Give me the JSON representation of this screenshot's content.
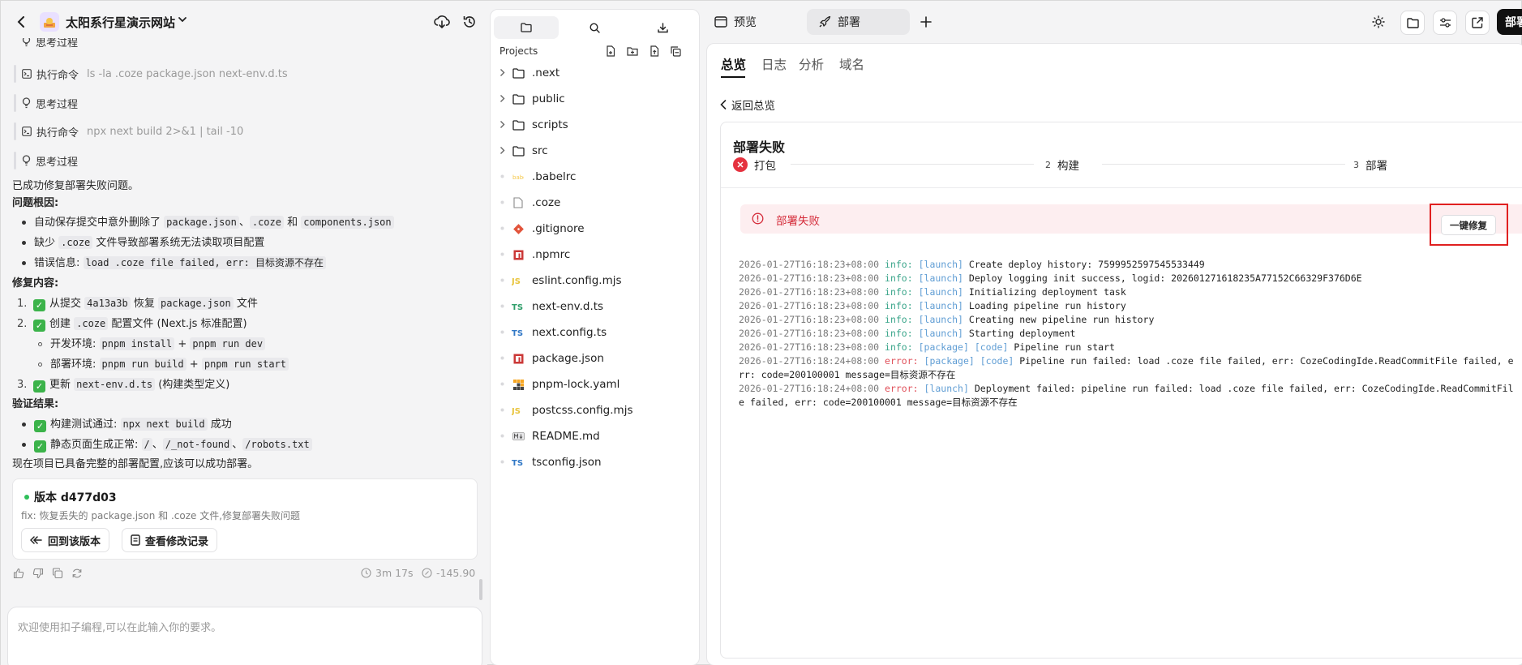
{
  "chat": {
    "project_title": "太阳系行星演示网站",
    "steps": [
      {
        "label": "思考过程",
        "cmd": ""
      },
      {
        "label": "执行命令",
        "cmd": "ls -la .coze package.json next-env.d.ts"
      },
      {
        "label": "思考过程",
        "cmd": ""
      },
      {
        "label": "执行命令",
        "cmd": "npx next build 2>&1 | tail -10"
      },
      {
        "label": "思考过程",
        "cmd": ""
      }
    ],
    "summary": "已成功修复部署失败问题。",
    "root_cause_heading": "问题根因:",
    "root_causes": {
      "c1_pre": "自动保存提交中意外删除了 ",
      "c1_code1": "package.json",
      "c1_sep": "、",
      "c1_code2": ".coze",
      "c1_and": " 和 ",
      "c1_code3": "components.json",
      "c2_pre": "缺少 ",
      "c2_code": ".coze",
      "c2_post": " 文件导致部署系统无法读取项目配置",
      "c3_pre": "错误信息: ",
      "c3_code": "load .coze file failed, err: 目标资源不存在"
    },
    "fix_heading": "修复内容:",
    "fixes": {
      "f1_num": "1.",
      "f1_check": "✓",
      "f1_pre": "从提交 ",
      "f1_code": "4a13a3b",
      "f1_mid": " 恢复 ",
      "f1_code2": "package.json",
      "f1_post": " 文件",
      "f2_num": "2.",
      "f2_check": "✓",
      "f2_pre": "创建 ",
      "f2_code": ".coze",
      "f2_post": " 配置文件 (Next.js 标准配置)",
      "f2_sub1_pre": "开发环境: ",
      "f2_sub1_code1": "pnpm install",
      "f2_sub1_plus": " + ",
      "f2_sub1_code2": "pnpm run dev",
      "f2_sub2_pre": "部署环境: ",
      "f2_sub2_code1": "pnpm run build",
      "f2_sub2_plus": " + ",
      "f2_sub2_code2": "pnpm run start",
      "f3_num": "3.",
      "f3_check": "✓",
      "f3_pre": "更新 ",
      "f3_code": "next-env.d.ts",
      "f3_post": " (构建类型定义)"
    },
    "verify_heading": "验证结果:",
    "verify": {
      "v1_check": "✓",
      "v1_pre": "构建测试通过: ",
      "v1_code": "npx next build",
      "v1_post": " 成功",
      "v2_check": "✓",
      "v2_pre": "静态页面生成正常: ",
      "v2_code1": "/",
      "v2_sep1": "、",
      "v2_code2": "/_not-found",
      "v2_sep2": "、",
      "v2_code3": "/robots.txt"
    },
    "conclusion": "现在项目已具备完整的部署配置,应该可以成功部署。",
    "version": {
      "title": "版本 d477d03",
      "message": "fix: 恢复丢失的 package.json 和 .coze 文件,修复部署失败问题",
      "revert_label": "回到该版本",
      "history_label": "查看修改记录"
    },
    "duration": "3m 17s",
    "credits": "-145.90",
    "input_placeholder": "欢迎使用扣子编程,可以在此输入你的要求。"
  },
  "explorer": {
    "label": "Projects",
    "items": [
      {
        "name": ".next",
        "type": "folder"
      },
      {
        "name": "public",
        "type": "folder"
      },
      {
        "name": "scripts",
        "type": "folder"
      },
      {
        "name": "src",
        "type": "folder"
      },
      {
        "name": ".babelrc",
        "type": "babel"
      },
      {
        "name": ".coze",
        "type": "file"
      },
      {
        "name": ".gitignore",
        "type": "git"
      },
      {
        "name": ".npmrc",
        "type": "npm"
      },
      {
        "name": "eslint.config.mjs",
        "type": "js"
      },
      {
        "name": "next-env.d.ts",
        "type": "ts"
      },
      {
        "name": "next.config.ts",
        "type": "ts-blue"
      },
      {
        "name": "package.json",
        "type": "npm"
      },
      {
        "name": "pnpm-lock.yaml",
        "type": "pnpm"
      },
      {
        "name": "postcss.config.mjs",
        "type": "js"
      },
      {
        "name": "README.md",
        "type": "md"
      },
      {
        "name": "tsconfig.json",
        "type": "ts-blue"
      }
    ],
    "icon_js": "JS",
    "icon_ts": "TS"
  },
  "topbar": {
    "preview_label": "预览",
    "deploy_tab_label": "部署",
    "deploy_button_label": "部署"
  },
  "panel": {
    "tabs": [
      "总览",
      "日志",
      "分析",
      "域名"
    ],
    "back_label": "返回总览",
    "title": "部署失败",
    "stages": [
      {
        "num": "",
        "label": "打包",
        "status": "failed"
      },
      {
        "num": "2",
        "label": "构建",
        "status": "pending"
      },
      {
        "num": "3",
        "label": "部署",
        "status": "pending"
      }
    ],
    "alert_text": "部署失败",
    "fix_label": "一键修复",
    "logs": [
      {
        "ts": "2026-01-27T16:18:23+08:00",
        "level": "info:",
        "tags": "[launch]",
        "msg": "Create deploy history: 7599952597545533449"
      },
      {
        "ts": "2026-01-27T16:18:23+08:00",
        "level": "info:",
        "tags": "[launch]",
        "msg": "Deploy logging init success, logid: 202601271618235A77152C66329F376D6E"
      },
      {
        "ts": "2026-01-27T16:18:23+08:00",
        "level": "info:",
        "tags": "[launch]",
        "msg": "Initializing deployment task"
      },
      {
        "ts": "2026-01-27T16:18:23+08:00",
        "level": "info:",
        "tags": "[launch]",
        "msg": "Loading pipeline run history"
      },
      {
        "ts": "2026-01-27T16:18:23+08:00",
        "level": "info:",
        "tags": "[launch]",
        "msg": "Creating new pipeline run history"
      },
      {
        "ts": "2026-01-27T16:18:23+08:00",
        "level": "info:",
        "tags": "[launch]",
        "msg": "Starting deployment"
      },
      {
        "ts": "2026-01-27T16:18:23+08:00",
        "level": "info:",
        "tags": "[package] [code]",
        "msg": "Pipeline run start"
      },
      {
        "ts": "2026-01-27T16:18:24+08:00",
        "level": "error:",
        "tags": "[package] [code]",
        "msg": "Pipeline run failed: load .coze file failed, err: CozeCodingIde.ReadCommitFile failed, err: code=200100001 message=目标资源不存在"
      },
      {
        "ts": "2026-01-27T16:18:24+08:00",
        "level": "error:",
        "tags": "[launch]",
        "msg": "Deployment failed: pipeline run failed: load .coze file failed, err: CozeCodingIde.ReadCommitFile failed, err: code=200100001 message=目标资源不存在"
      }
    ]
  },
  "colors": {
    "accent_red": "#e5323f",
    "info_green": "#3aa58a",
    "tag_blue": "#5f9dd4",
    "success_green": "#3bb34a"
  }
}
